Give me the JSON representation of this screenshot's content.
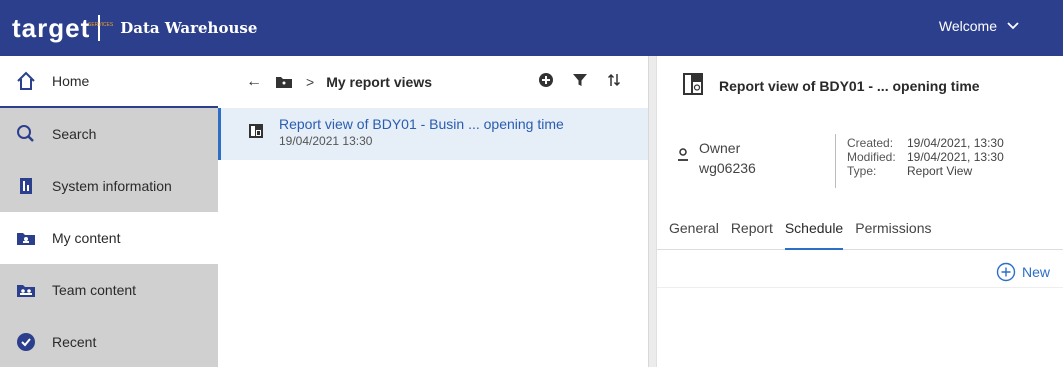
{
  "header": {
    "logo_text": "target",
    "logo_sub": "SERVICES",
    "app_title": "Data Warehouse",
    "welcome_label": "Welcome"
  },
  "sidebar": {
    "items": [
      {
        "label": "Home",
        "icon": "home-icon"
      },
      {
        "label": "Search",
        "icon": "search-icon"
      },
      {
        "label": "System information",
        "icon": "system-info-icon"
      },
      {
        "label": "My content",
        "icon": "folder-user-icon"
      },
      {
        "label": "Team content",
        "icon": "folder-team-icon"
      },
      {
        "label": "Recent",
        "icon": "recent-icon"
      }
    ]
  },
  "content": {
    "breadcrumb_title": "My report views",
    "items": [
      {
        "title": "Report view of BDY01 - Busin ... opening time",
        "date": "19/04/2021 13:30"
      }
    ]
  },
  "details": {
    "title": "Report view of BDY01 - ... opening time",
    "owner_label": "Owner",
    "owner_value": "wg06236",
    "meta": {
      "created_label": "Created:",
      "created_value": "19/04/2021, 13:30",
      "modified_label": "Modified:",
      "modified_value": "19/04/2021, 13:30",
      "type_label": "Type:",
      "type_value": "Report View"
    },
    "tabs": [
      "General",
      "Report",
      "Schedule",
      "Permissions"
    ],
    "active_tab": "Schedule",
    "new_label": "New"
  },
  "colors": {
    "header_bg": "#2b3f8c",
    "sidebar_bg": "#d0d0d0",
    "accent": "#2b6fc7",
    "selected_bg": "#e6eef8"
  }
}
